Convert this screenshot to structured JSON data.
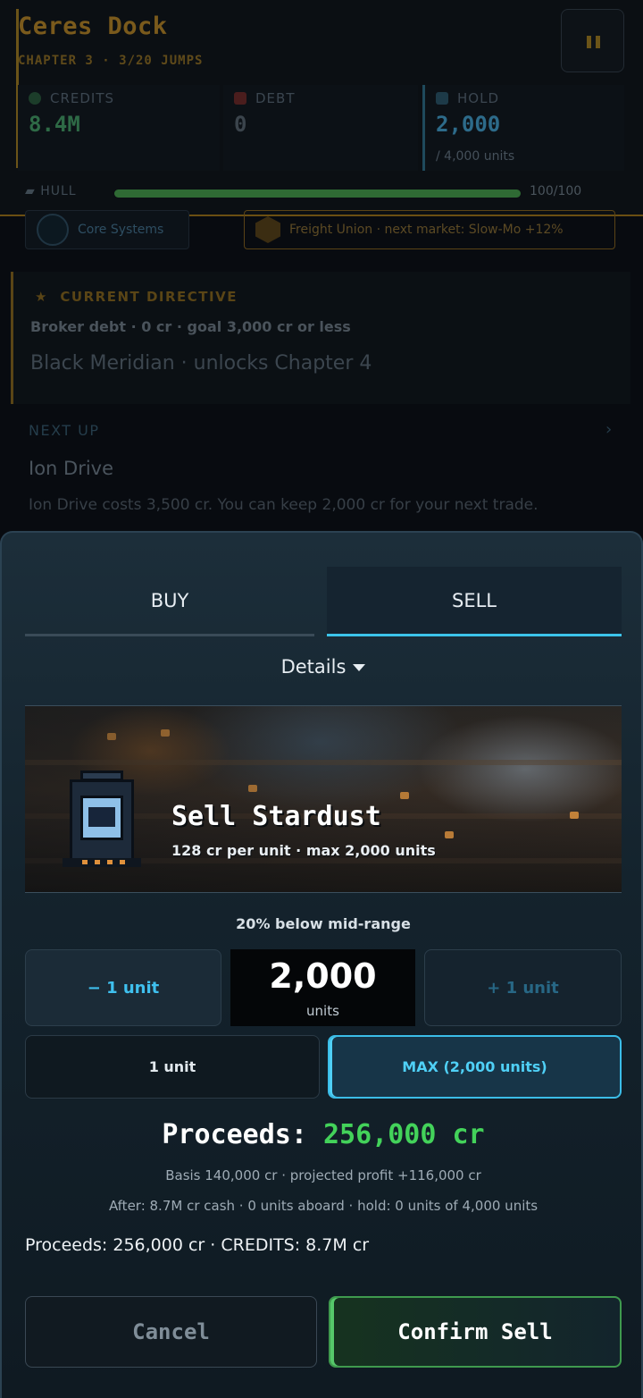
{
  "hud": {
    "location": "Ceres Dock",
    "chapter": "CHAPTER 3 · 3/20 JUMPS",
    "credits_label": "CREDITS",
    "credits_value": "8.4M",
    "debt_label": "DEBT",
    "debt_value": "0",
    "hold_label": "HOLD",
    "hold_value": "2,000",
    "hold_capacity": "/ 4,000 units",
    "hull_label": "HULL",
    "hull_value": "100/100",
    "hull_fraction": 1.0,
    "colors": {
      "gold": "#7a5a1c",
      "credits": "#2e6a46",
      "debt": "#5a2a2a",
      "hold": "#2d6b8a"
    }
  },
  "chips": {
    "core": "Core Systems",
    "union": "Freight Union · next market: Slow-Mo +12%"
  },
  "directive": {
    "heading": "CURRENT DIRECTIVE",
    "goal": "Broker debt · 0 cr · goal 3,000 cr or less",
    "unlock": "Black Meridian · unlocks Chapter 4"
  },
  "next_up": {
    "label": "NEXT UP",
    "chevron": "›",
    "title": "Ion Drive",
    "description": "Ion Drive costs 3,500 cr. You can keep 2,000 cr for your next trade."
  },
  "trade": {
    "tabs": {
      "buy": "BUY",
      "sell": "SELL",
      "active": "SELL"
    },
    "details_label": "Details",
    "item_title": "Sell Stardust",
    "item_desc": "128 cr per unit · max 2,000 units",
    "price_note": "20% below mid-range",
    "minus_label": "− 1 unit",
    "plus_label": "+ 1 unit",
    "quantity": "2,000",
    "quantity_unit": "units",
    "preset_one": "1 unit",
    "preset_max": "MAX (2,000 units)",
    "proceeds_label": "Proceeds:",
    "proceeds_value": "256,000 cr",
    "basis_line": "Basis 140,000 cr · projected profit +116,000 cr",
    "after_line": "After: 8.7M cr cash · 0 units aboard · hold: 0 units of 4,000 units",
    "summary_line": "Proceeds: 256,000 cr · CREDITS: 8.7M cr",
    "cancel_label": "Cancel",
    "confirm_label": "Confirm Sell",
    "colors": {
      "accent": "#3cc4ea",
      "profit": "#43d25a",
      "confirm_border": "#3f9a4e"
    }
  },
  "icons": [
    "pause-icon",
    "credits-icon",
    "debt-icon",
    "hold-icon",
    "hull-icon",
    "core-systems-icon",
    "freight-union-icon",
    "star-icon",
    "chevron-right-icon",
    "caret-down-icon",
    "stardust-crate-icon"
  ]
}
